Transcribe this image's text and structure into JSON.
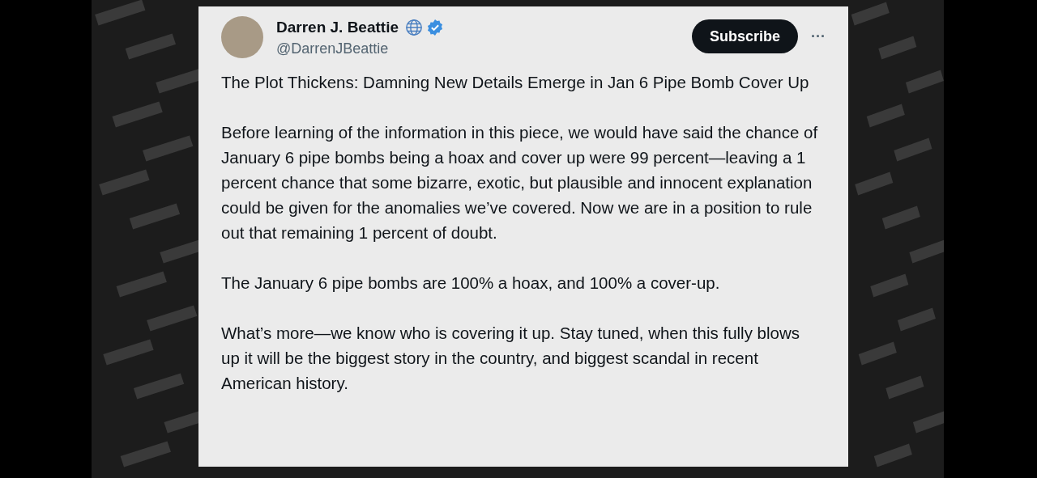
{
  "post": {
    "author": {
      "name": "Darren J. Beattie",
      "handle": "@DarrenJBeattie",
      "verified": true
    },
    "subscribe_button": "Subscribe",
    "more_button": "···",
    "paragraphs": [
      "The Plot Thickens: Damning New Details Emerge in Jan 6 Pipe Bomb Cover Up",
      "Before learning of the information in this piece, we would have said the chance of January 6 pipe bombs being a hoax and cover up were 99 percent—leaving a 1 percent chance that some bizarre, exotic, but plausible and innocent explanation could be given for the anomalies we’ve covered. Now we are in a position to rule out that remaining 1 percent of doubt.",
      "The January 6 pipe bombs are 100% a hoax, and 100% a cover-up.",
      "What’s more—we know who is covering it up. Stay tuned, when this fully blows up it will be the biggest story in the country, and biggest scandal in recent American history."
    ]
  }
}
